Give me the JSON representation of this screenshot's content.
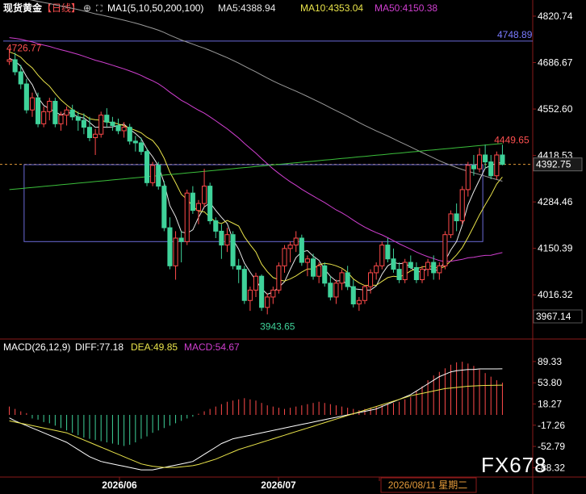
{
  "header": {
    "symbol": "现货黄金",
    "period": "【日线】",
    "ma_label": "MA1(5,10,50,200,100)",
    "ma5": "MA5:4388.94",
    "ma10": "MA10:4353.04",
    "ma50": "MA50:4150.38"
  },
  "macd_header": {
    "label": "MACD(26,12,9)",
    "diff": "DIFF:77.18",
    "dea": "DEA:49.85",
    "macd": "MACD:54.67"
  },
  "price_axis": {
    "ticks": [
      "4820.74",
      "4686.67",
      "4552.60",
      "4418.53",
      "4284.46",
      "4150.39",
      "4016.32"
    ],
    "current": "4392.75",
    "low_box": "3967.14",
    "range": [
      3940,
      4820.74
    ]
  },
  "macd_axis": {
    "ticks": [
      "89.33",
      "53.80",
      "18.27",
      "-17.26",
      "-52.79",
      "-88.32"
    ],
    "range": [
      -100,
      100
    ]
  },
  "annotations": {
    "high_left": "4726.77",
    "box_top": "4748.89",
    "recent_high": "4449.65",
    "low": "3943.65"
  },
  "date_labels": [
    "2026/06",
    "2026/07",
    "2026/08/11 星期二"
  ],
  "watermark": "FX678",
  "colors": {
    "up": "#ff4a4a",
    "down": "#3fd29a",
    "ma5": "#e8e8e8",
    "ma10": "#e9e34a",
    "ma50": "#d03fd0",
    "ma100": "#9a9a9a",
    "ma200": "#3bbf3b",
    "box": "#6a6ad8"
  },
  "chart_data": {
    "type": "candlestick",
    "count": 100,
    "ohlc": [
      [
        4690,
        4726,
        4680,
        4695
      ],
      [
        4695,
        4715,
        4650,
        4660
      ],
      [
        4660,
        4680,
        4610,
        4625
      ],
      [
        4625,
        4640,
        4540,
        4550
      ],
      [
        4550,
        4600,
        4530,
        4585
      ],
      [
        4585,
        4600,
        4500,
        4510
      ],
      [
        4510,
        4560,
        4500,
        4545
      ],
      [
        4545,
        4585,
        4520,
        4575
      ],
      [
        4575,
        4585,
        4500,
        4510
      ],
      [
        4510,
        4545,
        4490,
        4535
      ],
      [
        4535,
        4560,
        4505,
        4550
      ],
      [
        4550,
        4565,
        4520,
        4530
      ],
      [
        4530,
        4545,
        4490,
        4520
      ],
      [
        4520,
        4540,
        4480,
        4500
      ],
      [
        4500,
        4530,
        4460,
        4470
      ],
      [
        4470,
        4495,
        4420,
        4480
      ],
      [
        4480,
        4545,
        4470,
        4535
      ],
      [
        4535,
        4555,
        4500,
        4515
      ],
      [
        4515,
        4530,
        4490,
        4505
      ],
      [
        4505,
        4525,
        4480,
        4490
      ],
      [
        4490,
        4515,
        4470,
        4500
      ],
      [
        4500,
        4510,
        4450,
        4460
      ],
      [
        4460,
        4475,
        4430,
        4455
      ],
      [
        4455,
        4470,
        4420,
        4430
      ],
      [
        4430,
        4440,
        4330,
        4340
      ],
      [
        4340,
        4400,
        4330,
        4390
      ],
      [
        4390,
        4400,
        4320,
        4330
      ],
      [
        4330,
        4345,
        4200,
        4210
      ],
      [
        4210,
        4240,
        4090,
        4100
      ],
      [
        4100,
        4200,
        4060,
        4180
      ],
      [
        4180,
        4200,
        4110,
        4170
      ],
      [
        4170,
        4320,
        4160,
        4310
      ],
      [
        4310,
        4330,
        4250,
        4260
      ],
      [
        4260,
        4290,
        4220,
        4280
      ],
      [
        4280,
        4380,
        4270,
        4330
      ],
      [
        4330,
        4340,
        4220,
        4230
      ],
      [
        4230,
        4240,
        4180,
        4200
      ],
      [
        4200,
        4220,
        4120,
        4160
      ],
      [
        4160,
        4210,
        4140,
        4190
      ],
      [
        4190,
        4200,
        4090,
        4100
      ],
      [
        4100,
        4120,
        4050,
        4090
      ],
      [
        4090,
        4100,
        3990,
        4000
      ],
      [
        4000,
        4040,
        3970,
        4030
      ],
      [
        4030,
        4080,
        4010,
        4070
      ],
      [
        4070,
        4075,
        3970,
        3980
      ],
      [
        3980,
        4020,
        3960,
        4010
      ],
      [
        4010,
        4040,
        3990,
        4030
      ],
      [
        4030,
        4110,
        4020,
        4100
      ],
      [
        4100,
        4160,
        4080,
        4150
      ],
      [
        4150,
        4170,
        4110,
        4160
      ],
      [
        4160,
        4200,
        4140,
        4180
      ],
      [
        4180,
        4190,
        4100,
        4110
      ],
      [
        4110,
        4130,
        4070,
        4120
      ],
      [
        4120,
        4135,
        4060,
        4070
      ],
      [
        4070,
        4110,
        4050,
        4100
      ],
      [
        4100,
        4110,
        4040,
        4050
      ],
      [
        4050,
        4070,
        4000,
        4010
      ],
      [
        4010,
        4060,
        3990,
        4050
      ],
      [
        4050,
        4090,
        4030,
        4080
      ],
      [
        4080,
        4100,
        4030,
        4040
      ],
      [
        4040,
        4060,
        3980,
        3990
      ],
      [
        3990,
        4010,
        3970,
        4000
      ],
      [
        4000,
        4045,
        3990,
        4040
      ],
      [
        4040,
        4090,
        4020,
        4080
      ],
      [
        4080,
        4110,
        4060,
        4100
      ],
      [
        4100,
        4170,
        4090,
        4160
      ],
      [
        4160,
        4180,
        4110,
        4120
      ],
      [
        4120,
        4150,
        4080,
        4090
      ],
      [
        4090,
        4110,
        4050,
        4060
      ],
      [
        4060,
        4120,
        4050,
        4110
      ],
      [
        4110,
        4130,
        4090,
        4095
      ],
      [
        4095,
        4110,
        4050,
        4060
      ],
      [
        4060,
        4100,
        4050,
        4090
      ],
      [
        4090,
        4120,
        4070,
        4110
      ],
      [
        4110,
        4130,
        4060,
        4080
      ],
      [
        4080,
        4110,
        4060,
        4100
      ],
      [
        4100,
        4200,
        4090,
        4190
      ],
      [
        4190,
        4260,
        4180,
        4250
      ],
      [
        4250,
        4280,
        4200,
        4230
      ],
      [
        4230,
        4330,
        4220,
        4320
      ],
      [
        4320,
        4400,
        4300,
        4390
      ],
      [
        4390,
        4420,
        4360,
        4380
      ],
      [
        4380,
        4440,
        4370,
        4420
      ],
      [
        4420,
        4450,
        4380,
        4400
      ],
      [
        4400,
        4420,
        4350,
        4360
      ],
      [
        4360,
        4430,
        4350,
        4420
      ],
      [
        4420,
        4449.65,
        4390,
        4392.75
      ]
    ],
    "macd_hist": [
      14,
      10,
      6,
      3,
      -6,
      -8,
      -12,
      -14,
      -18,
      -22,
      -26,
      -30,
      -34,
      -38,
      -40,
      -42,
      -44,
      -46,
      -48,
      -50,
      -52,
      -50,
      -46,
      -40,
      -36,
      -30,
      -26,
      -22,
      -18,
      -14,
      -10,
      -6,
      -3,
      2,
      6,
      10,
      14,
      18,
      22,
      24,
      26,
      28,
      26,
      24,
      20,
      16,
      14,
      12,
      10,
      12,
      14,
      16,
      18,
      20,
      22,
      20,
      18,
      16,
      14,
      12,
      10,
      8,
      10,
      12,
      14,
      16,
      18,
      20,
      22,
      26,
      30,
      40,
      48,
      58,
      66,
      72,
      78,
      84,
      88,
      89,
      86,
      82,
      76,
      70,
      64,
      58,
      54
    ],
    "macd_diff": [
      -5,
      -10,
      -14,
      -18,
      -22,
      -26,
      -30,
      -34,
      -38,
      -42,
      -46,
      -52,
      -58,
      -64,
      -70,
      -74,
      -78,
      -80,
      -82,
      -84,
      -86,
      -88,
      -90,
      -92,
      -92,
      -92,
      -90,
      -88,
      -86,
      -84,
      -82,
      -80,
      -78,
      -72,
      -66,
      -60,
      -54,
      -48,
      -44,
      -40,
      -38,
      -36,
      -34,
      -32,
      -30,
      -28,
      -26,
      -24,
      -22,
      -20,
      -18,
      -16,
      -14,
      -12,
      -10,
      -8,
      -6,
      -4,
      -2,
      0,
      2,
      4,
      6,
      8,
      10,
      14,
      18,
      22,
      26,
      30,
      34,
      40,
      46,
      52,
      58,
      64,
      68,
      72,
      74,
      75,
      76,
      76,
      77,
      77,
      77,
      77,
      77.18
    ],
    "macd_dea": [
      -10,
      -12,
      -14,
      -16,
      -18,
      -20,
      -22,
      -24,
      -26,
      -28,
      -30,
      -34,
      -38,
      -42,
      -46,
      -50,
      -54,
      -58,
      -62,
      -66,
      -70,
      -74,
      -78,
      -82,
      -84,
      -86,
      -87,
      -88,
      -88,
      -88,
      -87,
      -86,
      -85,
      -83,
      -80,
      -77,
      -74,
      -70,
      -66,
      -62,
      -58,
      -55,
      -52,
      -49,
      -46,
      -43,
      -40,
      -37,
      -34,
      -31,
      -28,
      -25,
      -22,
      -19,
      -16,
      -13,
      -10,
      -7,
      -4,
      -1,
      2,
      5,
      8,
      11,
      14,
      17,
      20,
      23,
      26,
      29,
      32,
      34,
      36,
      38,
      40,
      42,
      44,
      45,
      46,
      47,
      48,
      48.5,
      49,
      49.3,
      49.5,
      49.7,
      49.85
    ]
  }
}
